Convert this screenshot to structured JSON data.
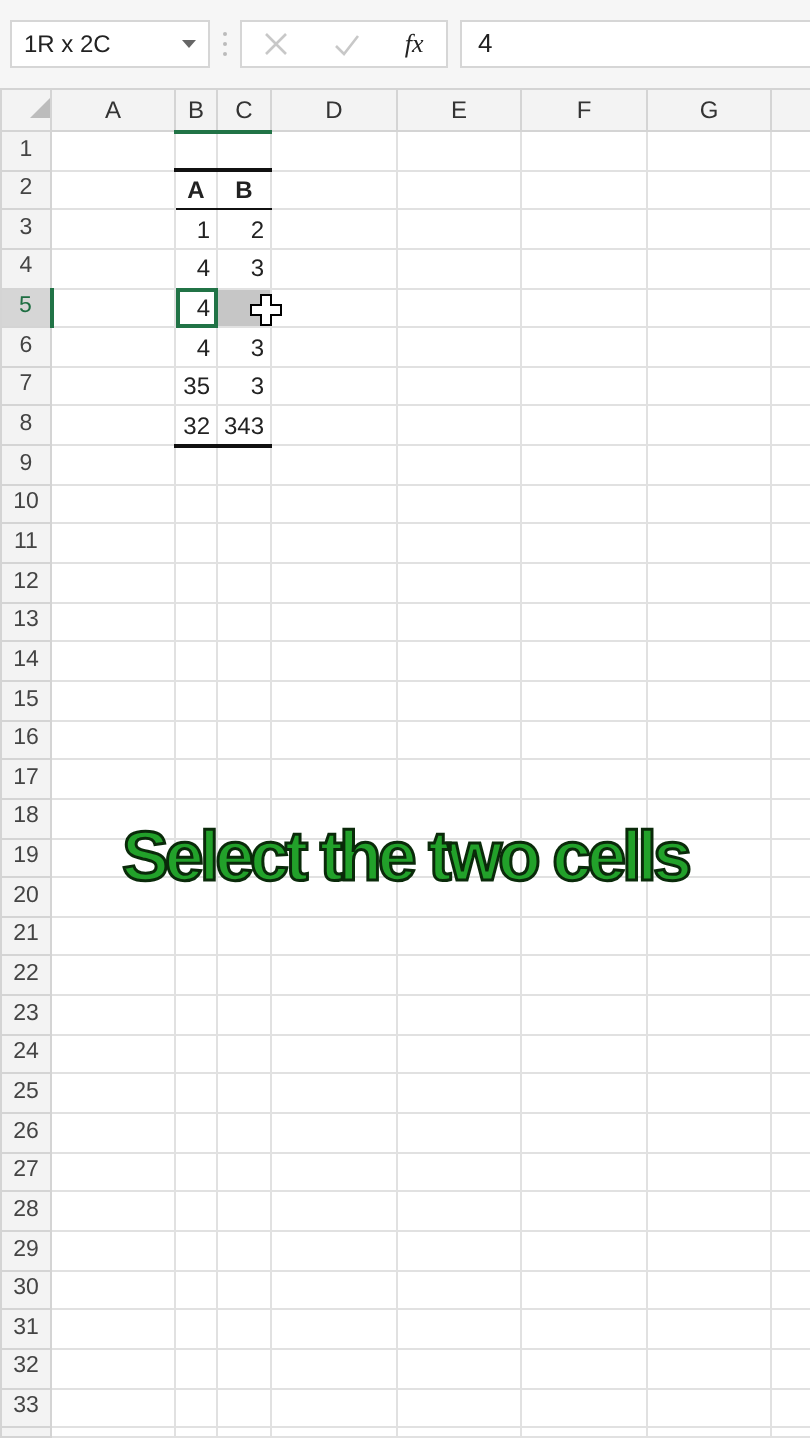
{
  "name_box": {
    "value": "1R x 2C"
  },
  "formula_bar": {
    "function_label": "fx",
    "value": "4",
    "cancel_disabled": true,
    "enter_disabled": true
  },
  "columns": [
    {
      "label": "A",
      "selected": false
    },
    {
      "label": "B",
      "selected": true
    },
    {
      "label": "C",
      "selected": true
    },
    {
      "label": "D",
      "selected": false
    },
    {
      "label": "E",
      "selected": false
    },
    {
      "label": "F",
      "selected": false
    },
    {
      "label": "G",
      "selected": false
    }
  ],
  "rows": [
    {
      "label": "1",
      "selected": false
    },
    {
      "label": "2",
      "selected": false,
      "kind": "header",
      "values": [
        {
          "text": "A",
          "selected": false,
          "active": false
        },
        {
          "text": "B",
          "selected": false,
          "active": false
        }
      ]
    },
    {
      "label": "3",
      "selected": false,
      "kind": "body",
      "values": [
        {
          "text": "1",
          "selected": false,
          "active": false
        },
        {
          "text": "2",
          "selected": false,
          "active": false
        }
      ]
    },
    {
      "label": "4",
      "selected": false,
      "kind": "body",
      "values": [
        {
          "text": "4",
          "selected": false,
          "active": false
        },
        {
          "text": "3",
          "selected": false,
          "active": false
        }
      ]
    },
    {
      "label": "5",
      "selected": true,
      "kind": "body",
      "values": [
        {
          "text": "4",
          "selected": true,
          "active": true
        },
        {
          "selected": true,
          "active": false
        }
      ]
    },
    {
      "label": "6",
      "selected": false,
      "kind": "body",
      "values": [
        {
          "text": "4",
          "selected": false,
          "active": false
        },
        {
          "text": "3",
          "selected": false,
          "active": false
        }
      ]
    },
    {
      "label": "7",
      "selected": false,
      "kind": "body",
      "values": [
        {
          "text": "35",
          "selected": false,
          "active": false
        },
        {
          "text": "3",
          "selected": false,
          "active": false
        }
      ]
    },
    {
      "label": "8",
      "selected": false,
      "kind": "end",
      "values": [
        {
          "text": "32",
          "selected": false,
          "active": false
        },
        {
          "text": "343",
          "selected": false,
          "active": false
        }
      ]
    },
    {
      "label": "9",
      "selected": false
    },
    {
      "label": "10",
      "selected": false
    },
    {
      "label": "11",
      "selected": false
    },
    {
      "label": "12",
      "selected": false
    },
    {
      "label": "13",
      "selected": false
    },
    {
      "label": "14",
      "selected": false
    },
    {
      "label": "15",
      "selected": false
    },
    {
      "label": "16",
      "selected": false
    },
    {
      "label": "17",
      "selected": false
    },
    {
      "label": "18",
      "selected": false
    },
    {
      "label": "19",
      "selected": false
    },
    {
      "label": "20",
      "selected": false
    },
    {
      "label": "21",
      "selected": false
    },
    {
      "label": "22",
      "selected": false
    },
    {
      "label": "23",
      "selected": false
    },
    {
      "label": "24",
      "selected": false
    },
    {
      "label": "25",
      "selected": false
    },
    {
      "label": "26",
      "selected": false
    },
    {
      "label": "27",
      "selected": false
    },
    {
      "label": "28",
      "selected": false
    },
    {
      "label": "29",
      "selected": false
    },
    {
      "label": "30",
      "selected": false
    },
    {
      "label": "31",
      "selected": false
    },
    {
      "label": "32",
      "selected": false
    },
    {
      "label": "33",
      "selected": false
    }
  ],
  "caption": {
    "text": "Select the two cells"
  }
}
